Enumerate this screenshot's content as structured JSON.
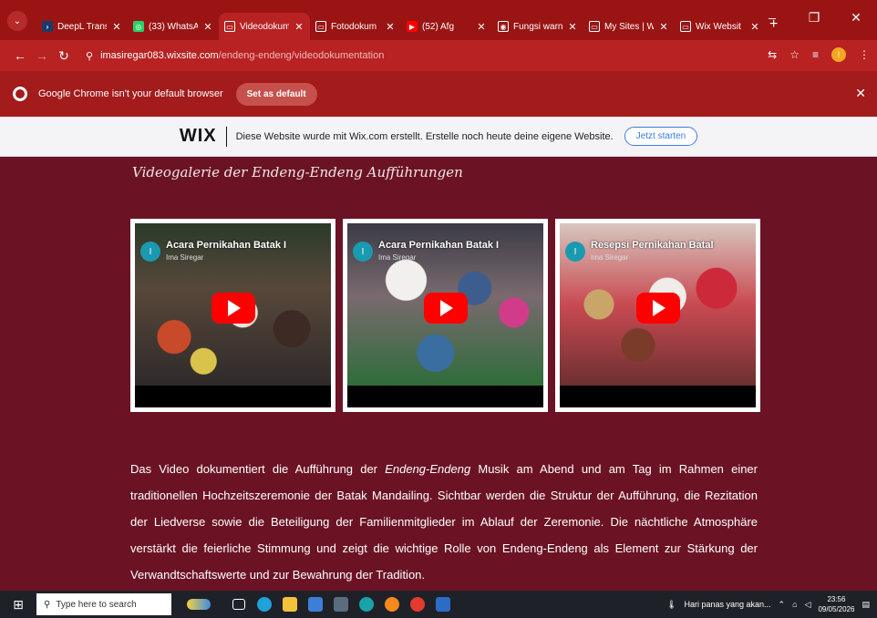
{
  "browser": {
    "tabs": [
      {
        "title": "DeepL Trans",
        "favicon_color": "#1a3a6b",
        "favicon": "›"
      },
      {
        "title": "(33) WhatsAp",
        "favicon_color": "#25d366",
        "favicon": "◎"
      },
      {
        "title": "Videodokum",
        "favicon_color": "#ffffff",
        "favicon": "▭",
        "active": true
      },
      {
        "title": "Fotodokum",
        "favicon_color": "#ffffff",
        "favicon": "▭"
      },
      {
        "title": "(52) Afg",
        "favicon_color": "#ff0000",
        "favicon": "▶"
      },
      {
        "title": "Fungsi warn",
        "favicon_color": "#ffffff",
        "favicon": "◉"
      },
      {
        "title": "My Sites | W",
        "favicon_color": "#ffffff",
        "favicon": "▭"
      },
      {
        "title": "Wix Websit",
        "favicon_color": "#ffffff",
        "favicon": "▭"
      }
    ],
    "url_host": "imasiregar083.wixsite.com",
    "url_path": "/endeng-endeng/videodokumentation",
    "infobar_message": "Google Chrome isn't your default browser",
    "infobar_button": "Set as default"
  },
  "wix_banner": {
    "logo": "WIX",
    "message": "Diese Website wurde mit Wix.com erstellt. Erstelle noch heute deine eigene Website.",
    "cta": "Jetzt starten"
  },
  "page": {
    "heading": "Videogalerie der Endeng-Endeng Aufführungen",
    "videos": [
      {
        "title": "Acara Pernikahan Batak I",
        "channel": "Ima Siregar",
        "avatar": "I"
      },
      {
        "title": "Acara Pernikahan Batak I",
        "channel": "Ima Siregar",
        "avatar": "I"
      },
      {
        "title": "Resepsi Pernikahan Batal",
        "channel": "Ima Siregar",
        "avatar": "I"
      }
    ],
    "description_before": "Das Video dokumentiert die Aufführung der ",
    "description_italic": "Endeng-Endeng",
    "description_after": " Musik am Abend und am Tag im Rahmen einer traditionellen Hochzeitszeremonie der Batak Mandailing. Sichtbar werden die Struktur der Aufführung, die Rezitation der Liedverse sowie die Beteiligung der Familienmitglieder im Ablauf der Zeremonie. Die nächtliche Atmosphäre verstärkt die feierliche Stimmung und zeigt die wichtige Rolle von Endeng-Endeng als Element zur Stärkung der Verwandtschaftswerte und zur Bewahrung der Tradition."
  },
  "taskbar": {
    "search_placeholder": "Type here to search",
    "weather": "Hari panas yang akan...",
    "time": "23:56",
    "date": "09/05/2026"
  }
}
